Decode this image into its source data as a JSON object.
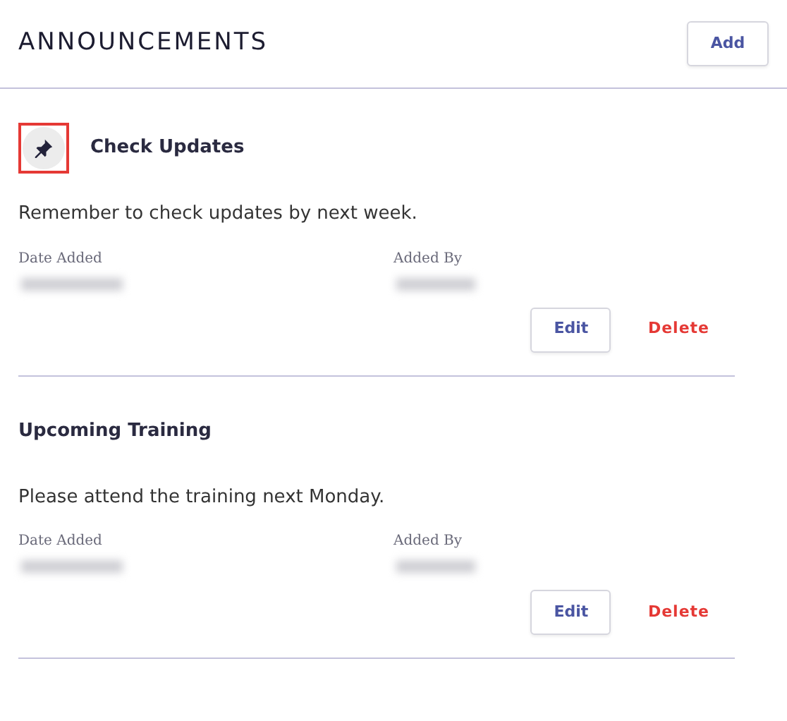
{
  "header": {
    "title": "ANNOUNCEMENTS",
    "add_button": "Add"
  },
  "announcements": [
    {
      "title": "Check Updates",
      "pinned": true,
      "message": "Remember to check updates by next week.",
      "date_label": "Date Added",
      "author_label": "Added By",
      "edit": "Edit",
      "delete": "Delete"
    },
    {
      "title": "Upcoming Training",
      "pinned": false,
      "message": "Please attend the training next Monday.",
      "date_label": "Date Added",
      "author_label": "Added By",
      "edit": "Edit",
      "delete": "Delete"
    }
  ]
}
